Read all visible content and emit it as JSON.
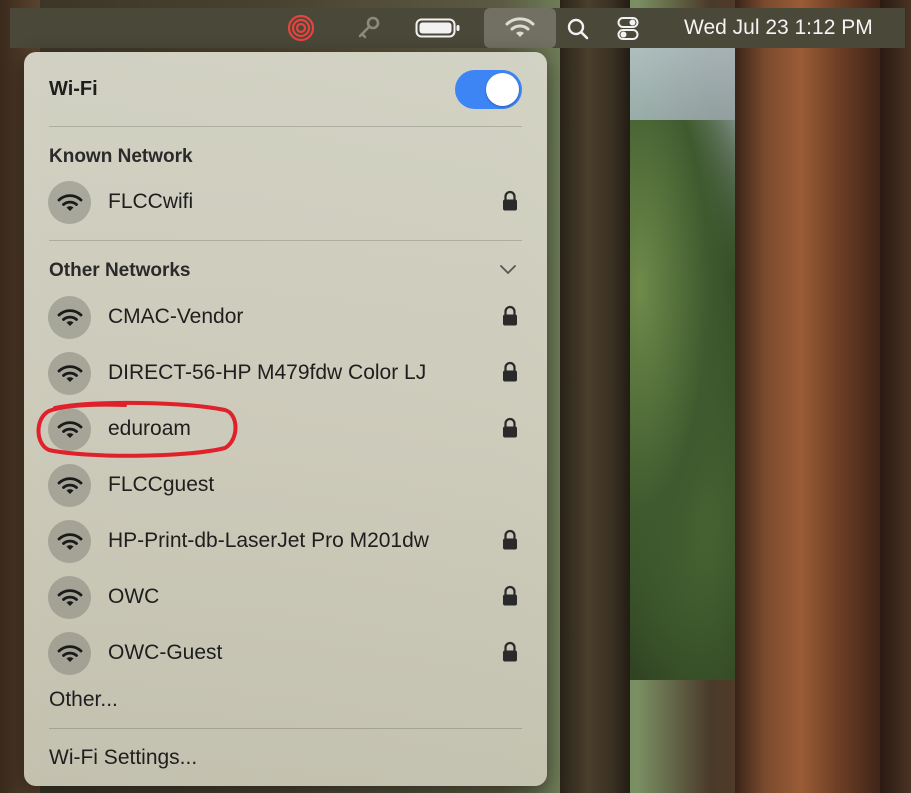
{
  "menubar": {
    "clock": "Wed Jul 23  1:12 PM",
    "icons": [
      "app-status-icon",
      "key-icon",
      "battery-icon",
      "wifi-icon",
      "spotlight-search-icon",
      "control-center-icon"
    ]
  },
  "wifi_panel": {
    "title": "Wi-Fi",
    "toggle_on": true,
    "accent_color": "#3d85f5",
    "known_header": "Known Network",
    "known_networks": [
      {
        "name": "FLCCwifi",
        "locked": true
      }
    ],
    "other_header": "Other Networks",
    "other_networks": [
      {
        "name": "CMAC-Vendor",
        "locked": true
      },
      {
        "name": "DIRECT-56-HP M479fdw Color LJ",
        "locked": true
      },
      {
        "name": "eduroam",
        "locked": true
      },
      {
        "name": "FLCCguest",
        "locked": false
      },
      {
        "name": "HP-Print-db-LaserJet Pro M201dw",
        "locked": true
      },
      {
        "name": "OWC",
        "locked": true
      },
      {
        "name": "OWC-Guest",
        "locked": true
      }
    ],
    "other_item": "Other...",
    "settings_item": "Wi-Fi Settings...",
    "annotation_color": "#e0202a"
  }
}
